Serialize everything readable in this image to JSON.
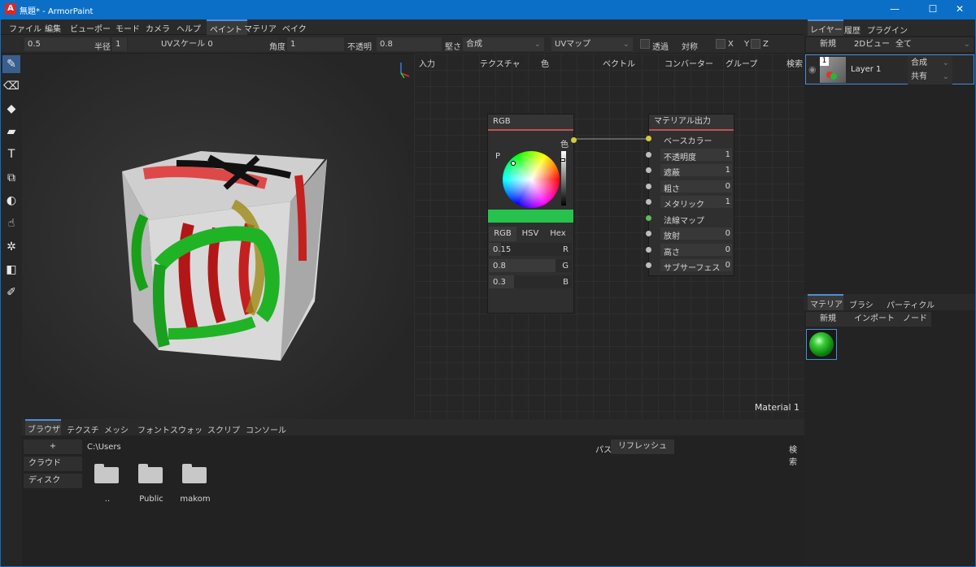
{
  "window": {
    "title": "無題* - ArmorPaint",
    "logo_letter": "A",
    "controls": {
      "minimize": "—",
      "maximize": "☐",
      "close": "✕"
    }
  },
  "menu": {
    "items": [
      "ファイル",
      "編集",
      "ビューポー",
      "モード",
      "カメラ",
      "ヘルプ"
    ],
    "workspace_tabs": [
      "ペイント",
      "マテリア",
      "ベイク"
    ]
  },
  "tool_options": {
    "brush_value": "0.5",
    "radius_label": "半径",
    "radius_value": "1",
    "uv_scale": "UVスケール 0",
    "angle_label": "角度",
    "angle_value": "1",
    "opacity_label": "不透明",
    "opacity_value": "0.8",
    "hardness_label": "堅さ",
    "blend_value": "合成",
    "uv_map_value": "UVマップ",
    "transparent_label": "透過",
    "symmetry_label": "対称",
    "axis_x": "X",
    "axis_y": "Y",
    "axis_z": "Z"
  },
  "tools": [
    {
      "icon": "brush-icon",
      "glyph": "✎"
    },
    {
      "icon": "eraser-icon",
      "glyph": "⌫"
    },
    {
      "icon": "fill-icon",
      "glyph": "◆"
    },
    {
      "icon": "decal-icon",
      "glyph": "▰"
    },
    {
      "icon": "text-icon",
      "glyph": "T"
    },
    {
      "icon": "clone-icon",
      "glyph": "⧉"
    },
    {
      "icon": "blur-icon",
      "glyph": "◐"
    },
    {
      "icon": "particle-icon",
      "glyph": "☝"
    },
    {
      "icon": "bake-icon",
      "glyph": "✲"
    },
    {
      "icon": "colorid-icon",
      "glyph": "◧"
    },
    {
      "icon": "picker-icon",
      "glyph": "✐"
    }
  ],
  "node_menu": [
    "入力",
    "テクスチャ",
    "色",
    "ベクトル",
    "コンバーター",
    "グループ",
    "検索"
  ],
  "rgb_node": {
    "title": "RGB",
    "output_label": "色",
    "picker_btn": "P",
    "color": "#26c24d",
    "modes": [
      "RGB",
      "HSV",
      "Hex"
    ],
    "channels": [
      {
        "value": "0.15",
        "label": "R",
        "fill": 0.15
      },
      {
        "value": "0.8",
        "label": "G",
        "fill": 0.8
      },
      {
        "value": "0.3",
        "label": "B",
        "fill": 0.3
      }
    ]
  },
  "output_node": {
    "title": "マテリアル出力",
    "inputs": [
      {
        "label": "ベースカラー",
        "value": "",
        "socket": "#d8c93a"
      },
      {
        "label": "不透明度",
        "value": "1",
        "socket": "#bdbdbd"
      },
      {
        "label": "遮蔽",
        "value": "1",
        "socket": "#bdbdbd"
      },
      {
        "label": "粗さ",
        "value": "0",
        "socket": "#bdbdbd"
      },
      {
        "label": "メタリック",
        "value": "1",
        "socket": "#bdbdbd"
      },
      {
        "label": "法線マップ",
        "value": "",
        "socket": "#5dbb5d"
      },
      {
        "label": "放射",
        "value": "0",
        "socket": "#bdbdbd"
      },
      {
        "label": "高さ",
        "value": "0",
        "socket": "#bdbdbd"
      },
      {
        "label": "サブサーフェス",
        "value": "0",
        "socket": "#bdbdbd"
      }
    ]
  },
  "material_name": "Material 1",
  "bottom": {
    "tabs": [
      "ブラウザ",
      "テクスチ",
      "メッシ",
      "フォント",
      "スウォッ",
      "スクリプ",
      "コンソール"
    ],
    "add_btn": "+",
    "path": "C:\\Users",
    "path_label": "パス",
    "refresh": "リフレッシュ",
    "search": "検索",
    "side_buttons": [
      "クラウド",
      "ディスク"
    ],
    "folders": [
      "..",
      "Public",
      "makom"
    ]
  },
  "right": {
    "tabs": [
      "レイヤー",
      "履歴",
      "プラグイン"
    ],
    "new_btn": "新規",
    "view_2d": "2Dビュー",
    "filter": "全て",
    "layer": {
      "index": "1",
      "name": "Layer 1",
      "blend": "合成",
      "mask": "共有"
    },
    "material_tabs": [
      "マテリア",
      "ブラシ",
      "パーティクル"
    ],
    "material_buttons": [
      "新規",
      "インポート",
      "ノード"
    ]
  }
}
